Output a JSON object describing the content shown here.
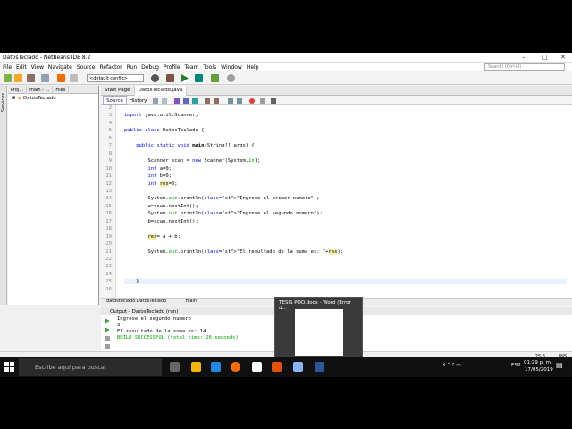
{
  "window": {
    "title": "DatosTeclado - NetBeans IDE 8.2",
    "minimize": "–",
    "maximize": "□",
    "close": "✕"
  },
  "menu": [
    "File",
    "Edit",
    "View",
    "Navigate",
    "Source",
    "Refactor",
    "Run",
    "Debug",
    "Profile",
    "Team",
    "Tools",
    "Window",
    "Help"
  ],
  "search": {
    "placeholder": "Search (Ctrl+I)"
  },
  "toolbar": {
    "config": "<default config>"
  },
  "sidebar": {
    "label": "Services"
  },
  "project_panel": {
    "tabs": [
      "Proj...",
      "main - ...",
      "Files"
    ],
    "tree_root": "DatosTeclado"
  },
  "editor": {
    "tabs": [
      "Start Page",
      "DatosTeclado.java"
    ],
    "modes": [
      "Source",
      "History"
    ],
    "lines": [
      {
        "n": "2",
        "t": ""
      },
      {
        "n": "3",
        "t": "import java.util.Scanner;"
      },
      {
        "n": "4",
        "t": ""
      },
      {
        "n": "5",
        "t": "public class DatosTeclado {"
      },
      {
        "n": "6",
        "t": ""
      },
      {
        "n": "7",
        "t": "    public static void main(String[] args) {"
      },
      {
        "n": "8",
        "t": ""
      },
      {
        "n": "9",
        "t": "        Scanner scan = new Scanner(System.in);"
      },
      {
        "n": "10",
        "t": "        int a=0;"
      },
      {
        "n": "11",
        "t": "        int b=0;"
      },
      {
        "n": "12",
        "t": "        int res=0;"
      },
      {
        "n": "13",
        "t": ""
      },
      {
        "n": "14",
        "t": "        System.out.println(\"Ingrese el primer numero\");"
      },
      {
        "n": "15",
        "t": "        a=scan.nextInt();"
      },
      {
        "n": "16",
        "t": "        System.out.println(\"Ingrese el segundo numero\");"
      },
      {
        "n": "17",
        "t": "        b=scan.nextInt();"
      },
      {
        "n": "18",
        "t": ""
      },
      {
        "n": "19",
        "t": "        res= a + b;"
      },
      {
        "n": "20",
        "t": ""
      },
      {
        "n": "21",
        "t": "        System.out.println(\"El resultado de la suma es: \"+res);"
      },
      {
        "n": "22",
        "t": ""
      },
      {
        "n": "23",
        "t": ""
      },
      {
        "n": "24",
        "t": ""
      },
      {
        "n": "25",
        "t": "    }"
      },
      {
        "n": "26",
        "t": ""
      }
    ],
    "breadcrumb": [
      "datosteclado.DatosTeclado",
      "main"
    ]
  },
  "output": {
    "tab": "Output - DatosTeclado (run)",
    "lines": [
      "Ingrese el segundo numero",
      "3",
      "El resultado de la suma es: 14",
      "BUILD SUCCESSFUL (total time: 26 seconds)"
    ]
  },
  "status": {
    "position": "25:6",
    "mode": "INS"
  },
  "word_preview": {
    "title": "TESIS POO.docx - Word (Error d..."
  },
  "taskbar": {
    "search_placeholder": "Escribe aquí para buscar",
    "time": "01:29 p. m.",
    "date": "17/05/2019",
    "lang": "ESP"
  }
}
